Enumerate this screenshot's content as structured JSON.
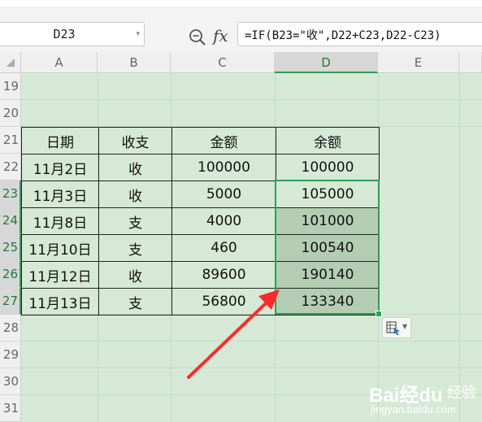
{
  "formula_bar": {
    "name_box": "D23",
    "formula": "=IF(B23=\"收\",D22+C23,D22-C23)",
    "zoom_icon": "magnifier-zoom-icon",
    "fx_label": "fx"
  },
  "columns": [
    "A",
    "B",
    "C",
    "D",
    "E"
  ],
  "selected_column": "D",
  "rows": [
    "19",
    "20",
    "21",
    "22",
    "23",
    "24",
    "25",
    "26",
    "27",
    "28",
    "29",
    "30",
    "31"
  ],
  "selected_rows": [
    "23",
    "24",
    "25",
    "26",
    "27"
  ],
  "table": {
    "headers": [
      "日期",
      "收支",
      "金额",
      "余额"
    ],
    "rows": [
      [
        "11月2日",
        "收",
        "100000",
        "100000"
      ],
      [
        "11月3日",
        "收",
        "5000",
        "105000"
      ],
      [
        "11月8日",
        "支",
        "4000",
        "101000"
      ],
      [
        "11月10日",
        "支",
        "460",
        "100540"
      ],
      [
        "11月12日",
        "收",
        "89600",
        "190140"
      ],
      [
        "11月13日",
        "支",
        "56800",
        "133340"
      ]
    ]
  },
  "selection": "D23:D27",
  "paste_options_icon": "paste-options-icon",
  "annotation": {
    "type": "red-arrow",
    "color": "#ff2a2a"
  },
  "watermark": {
    "logo": "Bai经du",
    "cn": "经验",
    "url": "jingyan.baidu.com"
  },
  "colors": {
    "sheet_bg": "#d6e9d6",
    "selection": "#2f9e57",
    "selected_fill": "#b3cdb3"
  }
}
